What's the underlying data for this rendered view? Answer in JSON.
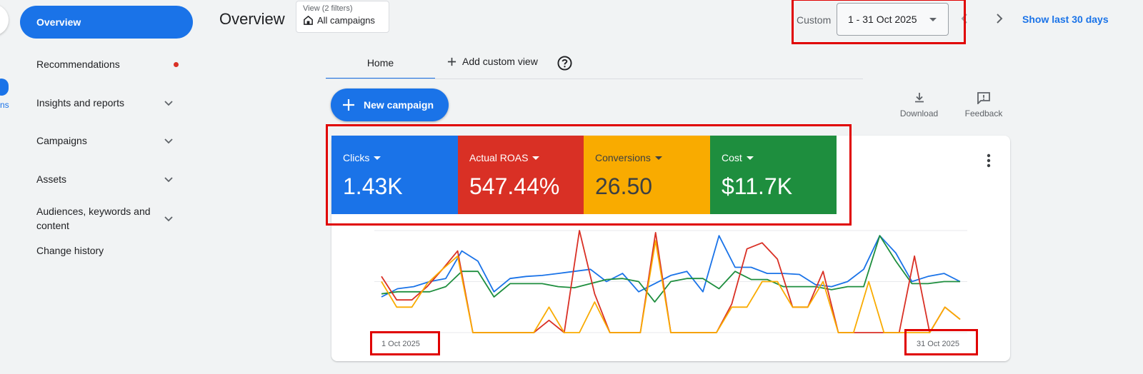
{
  "rail": {
    "label": "ns"
  },
  "sidebar": {
    "active": "Overview",
    "items": [
      {
        "label": "Recommendations"
      },
      {
        "label": "Insights and reports"
      },
      {
        "label": "Campaigns"
      },
      {
        "label": "Assets"
      },
      {
        "label": "Audiences, keywords and content"
      },
      {
        "label": "Change history"
      }
    ]
  },
  "header": {
    "title": "Overview",
    "filter_small": "View (2 filters)",
    "filter_big": "All campaigns",
    "date_label": "Custom",
    "date_range": "1 - 31 Oct 2025",
    "show_last": "Show last 30 days"
  },
  "tabs": {
    "home": "Home",
    "add": "Add custom view"
  },
  "actions": {
    "new_campaign": "New campaign",
    "download": "Download",
    "feedback": "Feedback"
  },
  "metrics": [
    {
      "label": "Clicks",
      "value": "1.43K",
      "color": "#1a73e8"
    },
    {
      "label": "Actual ROAS",
      "value": "547.44%",
      "color": "#d93025"
    },
    {
      "label": "Conversions",
      "value": "26.50",
      "color": "#f9ab00"
    },
    {
      "label": "Cost",
      "value": "$11.7K",
      "color": "#1e8e3e"
    }
  ],
  "chart_data": {
    "type": "line",
    "x_start": "1 Oct 2025",
    "x_end": "31 Oct 2025",
    "ylim": [
      0,
      100
    ],
    "series": [
      {
        "color": "#1a73e8",
        "values": [
          35,
          43,
          45,
          50,
          53,
          80,
          70,
          40,
          53,
          55,
          56,
          58,
          60,
          62,
          50,
          58,
          40,
          48,
          56,
          60,
          40,
          95,
          64,
          64,
          58,
          58,
          57,
          47,
          45,
          50,
          62,
          95,
          78,
          50,
          55,
          58,
          50
        ]
      },
      {
        "color": "#1e8e3e",
        "values": [
          38,
          40,
          40,
          40,
          45,
          60,
          60,
          35,
          48,
          48,
          48,
          45,
          44,
          48,
          52,
          53,
          50,
          30,
          50,
          53,
          53,
          43,
          60,
          52,
          52,
          45,
          45,
          45,
          42,
          45,
          45,
          95,
          70,
          48,
          48,
          50,
          50
        ]
      },
      {
        "color": "#d93025",
        "values": [
          55,
          32,
          32,
          45,
          62,
          80,
          0,
          0,
          0,
          0,
          0,
          12,
          0,
          100,
          38,
          0,
          0,
          0,
          98,
          0,
          0,
          0,
          0,
          28,
          82,
          88,
          72,
          25,
          25,
          60,
          0,
          0,
          0,
          0,
          0,
          75,
          0,
          25,
          13
        ]
      },
      {
        "color": "#f9ab00",
        "values": [
          50,
          25,
          25,
          48,
          62,
          75,
          0,
          0,
          0,
          0,
          0,
          25,
          0,
          0,
          30,
          0,
          0,
          0,
          90,
          0,
          0,
          0,
          0,
          25,
          25,
          50,
          50,
          25,
          25,
          50,
          0,
          0,
          50,
          0,
          0,
          0,
          0,
          25,
          13
        ]
      }
    ]
  }
}
